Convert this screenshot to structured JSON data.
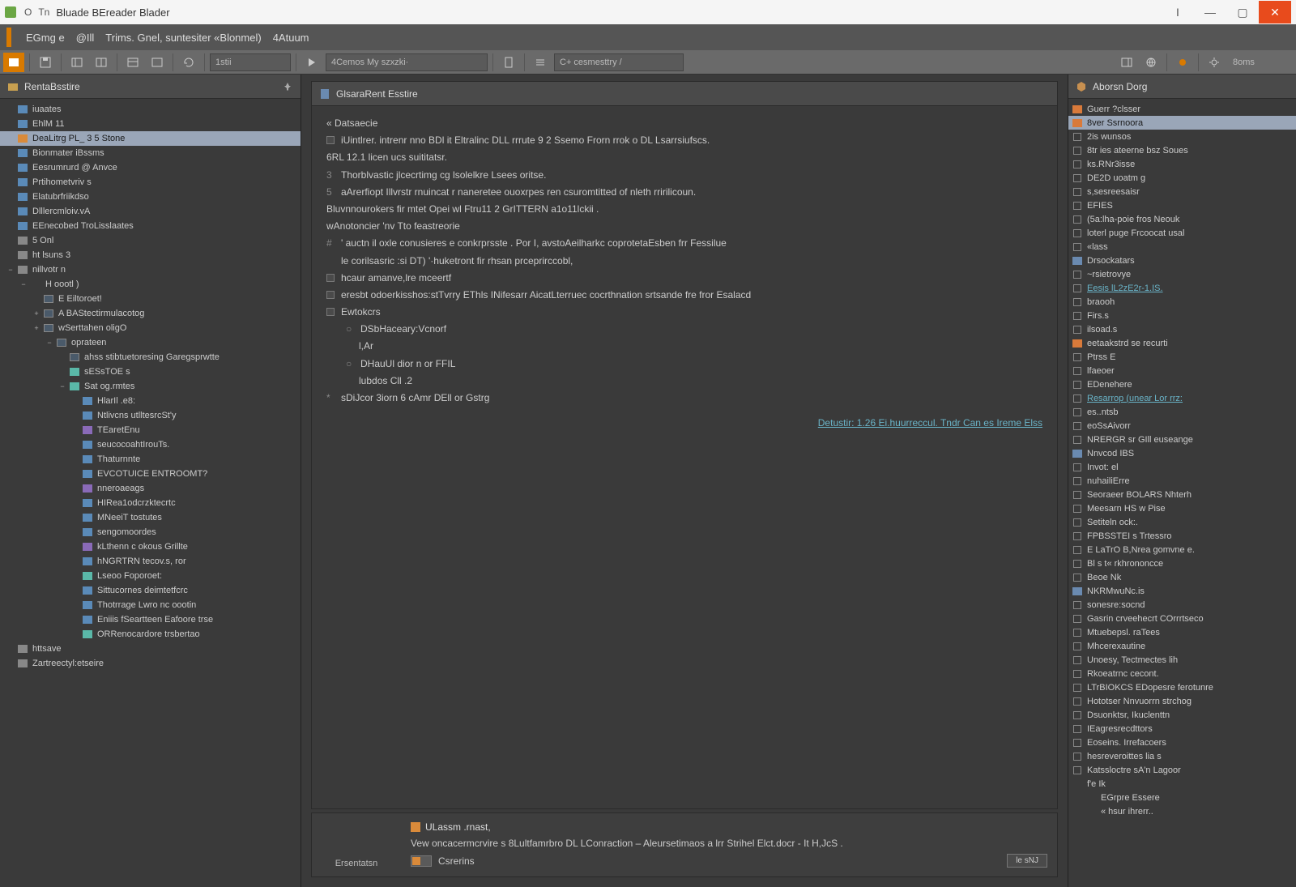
{
  "titlebar": {
    "prefix1": "O",
    "prefix2": "Tn",
    "title": "Bluade BEreader Blader"
  },
  "window_controls": {
    "min": "—",
    "max": "▢",
    "close": "✕",
    "extra": "I"
  },
  "menubar": {
    "items": [
      "EGmg e",
      "@Ill",
      "Trims. Gnel, suntesiter «Blonmel)",
      "4Atuum"
    ]
  },
  "toolbar": {
    "field1": "1stii",
    "field2": "4Cemos My szxzki·",
    "field3": "C+  cesmesttry /",
    "field4": "8oms"
  },
  "left_panel": {
    "title": "RentaBsstire",
    "tree": [
      {
        "d": 0,
        "tw": "",
        "ic": "blue",
        "label": "iuaates"
      },
      {
        "d": 0,
        "tw": "",
        "ic": "blue",
        "label": "EhlM   11"
      },
      {
        "d": 0,
        "tw": "",
        "ic": "orange",
        "label": "DeaLitrg  PL_ 3 5 Stone",
        "sel": true
      },
      {
        "d": 0,
        "tw": "",
        "ic": "blue",
        "label": "Bionmater iBssms"
      },
      {
        "d": 0,
        "tw": "",
        "ic": "blue",
        "label": "Eesrumrurd @ Anvce"
      },
      {
        "d": 0,
        "tw": "",
        "ic": "blue",
        "label": "Prtihometvriv s"
      },
      {
        "d": 0,
        "tw": "",
        "ic": "blue",
        "label": "Elatubrfriikdso"
      },
      {
        "d": 0,
        "tw": "",
        "ic": "blue",
        "label": "Dlllercmloiv.vA"
      },
      {
        "d": 0,
        "tw": "",
        "ic": "blue",
        "label": "EEnecobed TroLisslaates"
      },
      {
        "d": 0,
        "tw": "",
        "ic": "gray",
        "label": "5 Onl"
      },
      {
        "d": 0,
        "tw": "",
        "ic": "gray",
        "label": "ht lsuns 3"
      },
      {
        "d": 0,
        "tw": "−",
        "ic": "gray",
        "label": "nillvotr n"
      },
      {
        "d": 1,
        "tw": "−",
        "ic": "",
        "label": "H oootl )"
      },
      {
        "d": 2,
        "tw": "",
        "ic": "box",
        "label": "E Eiltoroet!"
      },
      {
        "d": 2,
        "tw": "+",
        "ic": "box",
        "label": "A BAStectirmulacotog"
      },
      {
        "d": 2,
        "tw": "+",
        "ic": "box",
        "label": "wSerttahen oligO"
      },
      {
        "d": 3,
        "tw": "−",
        "ic": "box",
        "label": "oprateen"
      },
      {
        "d": 4,
        "tw": "",
        "ic": "box",
        "label": "ahss stibtuetoresing Garegsprwtte"
      },
      {
        "d": 4,
        "tw": "",
        "ic": "teal",
        "label": "sESsTOE s"
      },
      {
        "d": 4,
        "tw": "−",
        "ic": "teal",
        "label": "Sat og.rmtes"
      },
      {
        "d": 5,
        "tw": "",
        "ic": "blue",
        "label": "HlarIl .e8:"
      },
      {
        "d": 5,
        "tw": "",
        "ic": "blue",
        "label": "Ntlivcns utlltesrcSt'y"
      },
      {
        "d": 5,
        "tw": "",
        "ic": "purple",
        "label": "TEaretEnu"
      },
      {
        "d": 5,
        "tw": "",
        "ic": "blue",
        "label": "seucocoahtIrouTs."
      },
      {
        "d": 5,
        "tw": "",
        "ic": "blue",
        "label": "Thaturnnte"
      },
      {
        "d": 5,
        "tw": "",
        "ic": "blue",
        "label": "EVCOTUICE  ENTROOMT?"
      },
      {
        "d": 5,
        "tw": "",
        "ic": "purple",
        "label": "nneroaeags"
      },
      {
        "d": 5,
        "tw": "",
        "ic": "blue",
        "label": "HIRea1odcrzktecrtc"
      },
      {
        "d": 5,
        "tw": "",
        "ic": "blue",
        "label": "MNeeiT tostutes"
      },
      {
        "d": 5,
        "tw": "",
        "ic": "blue",
        "label": "sengomoordes"
      },
      {
        "d": 5,
        "tw": "",
        "ic": "purple",
        "label": "kLthenn c okous Grillte"
      },
      {
        "d": 5,
        "tw": "",
        "ic": "blue",
        "label": "hNGRTRN tecov.s, ror"
      },
      {
        "d": 5,
        "tw": "",
        "ic": "teal",
        "label": "Lseoo Foporoet:"
      },
      {
        "d": 5,
        "tw": "",
        "ic": "blue",
        "label": "Sittucornes deimtetfcrc"
      },
      {
        "d": 5,
        "tw": "",
        "ic": "blue",
        "label": "Thotrrage Lwro nc oootin"
      },
      {
        "d": 5,
        "tw": "",
        "ic": "blue",
        "label": "Eniiis fSeartteen Eafoore trse"
      },
      {
        "d": 5,
        "tw": "",
        "ic": "teal",
        "label": "ORRenocardore trsbertao"
      },
      {
        "d": 0,
        "tw": "",
        "ic": "gray",
        "label": "httsave"
      },
      {
        "d": 0,
        "tw": "",
        "ic": "gray",
        "label": "Zartreectyl:etseire"
      }
    ]
  },
  "center": {
    "tab_title": "GlsaraRent Esstire",
    "lines": [
      {
        "k": "h",
        "text": "« Datsaecie"
      },
      {
        "k": "sq",
        "text": "iUintlrer. intrenr nno BDl it Eltralinc DLL rrrute  9 2 Ssemo Frorn  rrok o  DL Lsarrsiufscs."
      },
      {
        "k": "p",
        "text": "6RL 12.1 licen ucs suititatsr."
      },
      {
        "k": "n",
        "num": "3",
        "text": "Thorblvastic  jlcecrtimg cg  lsolelkre   Lsees oritse."
      },
      {
        "k": "n",
        "num": "5",
        "text": "aArerfiopt Illvrstr rnuincat  r naneretee ouoxrpes  ren csuromtitted of nleth  rririlicoun."
      },
      {
        "k": "p",
        "text": "Bluvnnourokers fir mtet Opei  wl Ftru11 2  GrITTERN  a1o11lckii ."
      },
      {
        "k": "p",
        "text": "wAnotoncier  'nv Tto feastreorie"
      },
      {
        "k": "n",
        "num": "#",
        "text": "' auctn  il oxle conusieres e conkrprsste . Por I,   avstoAeilharkc  coprotetaEsben frr Fessilue"
      },
      {
        "k": "p2",
        "text": "le corilsasric :si DT)                                         '·huketront fir rhsan prceprirccobl,"
      },
      {
        "k": "sq",
        "text": "hcaur  amanve,lre mceertf"
      },
      {
        "k": "sq",
        "text": "eresbt odoerkisshos:stTvrry  EThls INifesarr  AicatLterruec cocrthnation  srtsande fre fror Esalacd"
      },
      {
        "k": "sq",
        "text": "Ewtokcrs"
      },
      {
        "k": "b",
        "text": "DSbHaceary:Vcnorf"
      },
      {
        "k": "p3",
        "text": "l,Ar"
      },
      {
        "k": "b",
        "text": "DHauUl dior n or FFIL"
      },
      {
        "k": "p3",
        "text": "lubdos  Cll .2"
      },
      {
        "k": "n",
        "num": "*",
        "text": "sDiJcor 3iorn  6 cAmr DEll or Gstrg"
      }
    ],
    "footer_link": "Detustir: 1.26 Ei.huurreccul. Tndr Can es Ireme Elss",
    "notice": {
      "left_label": "Ersentatsn",
      "title": "ULassm .rnast,",
      "body": "Vew oncacermcrvire s 8Lultfamrbro  DL LConraction – Aleursetimaos a lrr Strihel Elct.docr -   It H,JcS .",
      "check_label": "Csrerins",
      "button": "le sNJ"
    }
  },
  "right_panel": {
    "title": "Aborsn Dorg",
    "items": [
      {
        "ic": "orange",
        "label": "Guerr ?clsser"
      },
      {
        "ic": "orange",
        "label": "8ver Ssrnoora",
        "sel": true
      },
      {
        "ic": "chk",
        "label": "2is wunsos"
      },
      {
        "ic": "chk",
        "label": "8tr ies ateerne bsz Soues"
      },
      {
        "ic": "chk",
        "label": "ks.RNr3isse"
      },
      {
        "ic": "chk",
        "label": "DE2D uoatm g"
      },
      {
        "ic": "chk",
        "label": "s,sesreesaisr"
      },
      {
        "ic": "chk",
        "label": "EFIES"
      },
      {
        "ic": "chk",
        "label": "(5a:lha-poie fros Neouk"
      },
      {
        "ic": "chk",
        "label": "loterl puge Frcoocat usal"
      },
      {
        "ic": "chk",
        "label": "«lass"
      },
      {
        "ic": "box",
        "label": "Drsockatars"
      },
      {
        "ic": "chk",
        "label": "~rsietrovye"
      },
      {
        "ic": "chk",
        "label": "Eesis  lL2zE2r-1.IS.",
        "link": true
      },
      {
        "ic": "chk",
        "label": "braooh"
      },
      {
        "ic": "chk",
        "label": "Firs.s"
      },
      {
        "ic": "chk",
        "label": "ilsoad.s"
      },
      {
        "ic": "orange",
        "label": "eetaakstrd se recurti"
      },
      {
        "ic": "chk",
        "label": "Ptrss E"
      },
      {
        "ic": "chk",
        "label": "lfaeoer"
      },
      {
        "ic": "chk",
        "label": "EDenehere"
      },
      {
        "ic": "chk",
        "label": "Resarrop (unear Lor rrz:",
        "link": true
      },
      {
        "ic": "chk",
        "label": "es..ntsb"
      },
      {
        "ic": "chk",
        "label": "eoSsAivorr"
      },
      {
        "ic": "chk",
        "label": "NRERGR  sr GIll euseange"
      },
      {
        "ic": "box",
        "label": "Nnvcod IBS"
      },
      {
        "ic": "chk",
        "label": "Invot: el"
      },
      {
        "ic": "chk",
        "label": "nuhailiErre"
      },
      {
        "ic": "chk",
        "label": "Seoraeer BOLARS Nhterh"
      },
      {
        "ic": "chk",
        "label": "Meesarn HS w Pise"
      },
      {
        "ic": "chk",
        "label": "Setiteln ock:."
      },
      {
        "ic": "chk",
        "label": "FPBSSTEI s Trtessro"
      },
      {
        "ic": "chk",
        "label": "E LaTrO  B,Nrea gomvne e."
      },
      {
        "ic": "chk",
        "label": "Bl s  t« rkhrononcce"
      },
      {
        "ic": "chk",
        "label": "Beoe  Nk"
      },
      {
        "ic": "box",
        "label": "NKRMwuNc.is"
      },
      {
        "ic": "chk",
        "label": "sonesre:socnd"
      },
      {
        "ic": "chk",
        "label": "Gasrin crveehecrt COrrrtseco"
      },
      {
        "ic": "chk",
        "label": "Mtuebepsl. raTees"
      },
      {
        "ic": "chk",
        "label": "Mhcerexautine"
      },
      {
        "ic": "chk",
        "label": "Unoesy, Tectmectes lih"
      },
      {
        "ic": "chk",
        "label": "Rkoeatrnc cecont."
      },
      {
        "ic": "chk",
        "label": "LTrBIOKCS EDopesre ferotunre"
      },
      {
        "ic": "chk",
        "label": "Hototser  Nnvuorrn strchog"
      },
      {
        "ic": "chk",
        "label": "Dsuonktsr, Ikuclenttn"
      },
      {
        "ic": "chk",
        "label": "IEagresrecdttors"
      },
      {
        "ic": "chk",
        "label": "Eoseins.  Irrefacoers"
      },
      {
        "ic": "chk",
        "label": "hesreveroittes lia s"
      },
      {
        "ic": "chk",
        "label": "Katssloctre sA'n Lagoor"
      },
      {
        "ic": "",
        "label": "f'e Ik"
      },
      {
        "ic": "",
        "label": "EGrpre Essere",
        "indent": true
      },
      {
        "ic": "",
        "label": "« hsur ihrerr..",
        "indent": true
      }
    ]
  }
}
